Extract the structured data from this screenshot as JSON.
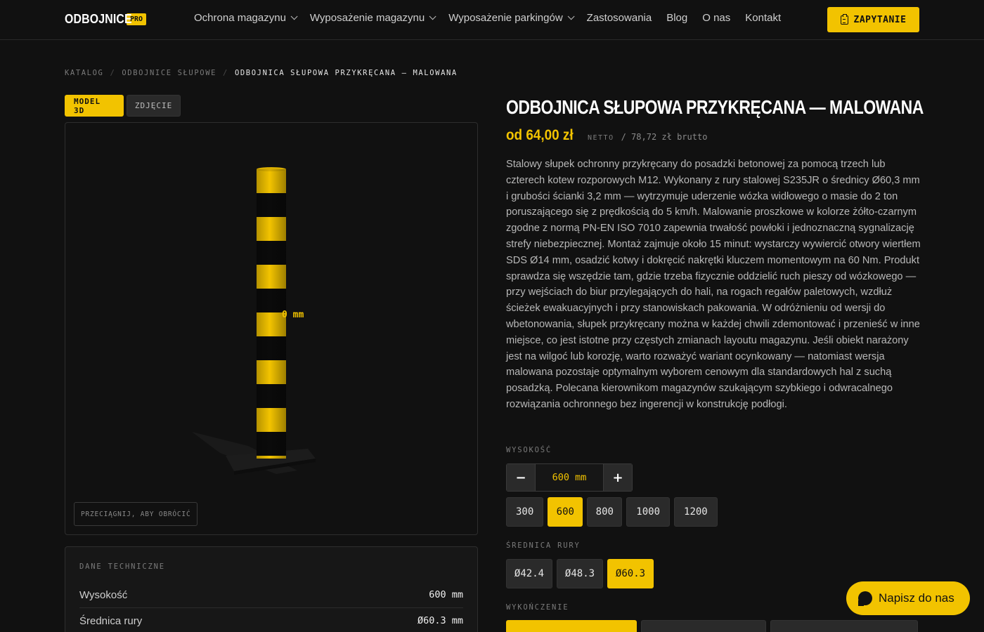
{
  "header": {
    "logo_text": "ODBOJNICE",
    "logo_badge": "PRO",
    "nav": [
      {
        "label": "Ochrona magazynu",
        "dropdown": true
      },
      {
        "label": "Wyposażenie magazynu",
        "dropdown": true
      },
      {
        "label": "Wyposażenie parkingów",
        "dropdown": true
      },
      {
        "label": "Zastosowania",
        "dropdown": false
      },
      {
        "label": "Blog",
        "dropdown": false
      },
      {
        "label": "O nas",
        "dropdown": false
      },
      {
        "label": "Kontakt",
        "dropdown": false
      }
    ],
    "cta_label": "ZAPYTANIE"
  },
  "breadcrumb": [
    "KATALOG",
    "ODBOJNICE SŁUPOWE",
    "ODBOJNICA SŁUPOWA PRZYKRĘCANA — MALOWANA"
  ],
  "viewer": {
    "tabs": [
      {
        "label": "MODEL 3D",
        "active": true
      },
      {
        "label": "ZDJĘCIE",
        "active": false
      }
    ],
    "dimension_label": "0 mm",
    "drag_hint": "PRZECIĄGNIJ, ABY OBRÓCIĆ"
  },
  "tech": {
    "title": "DANE TECHNICZNE",
    "rows": [
      {
        "key": "Wysokość",
        "value": "600 mm"
      },
      {
        "key": "Średnica rury",
        "value": "Ø60.3 mm"
      }
    ]
  },
  "product": {
    "title": "ODBOJNICA SŁUPOWA PRZYKRĘCANA — MALOWANA",
    "price_main": "od 64,00 zł",
    "price_net": "NETTO",
    "price_gross": "/ 78,72 zł brutto",
    "description": "Stalowy słupek ochronny przykręcany do posadzki betonowej za pomocą trzech lub czterech kotew rozporowych M12. Wykonany z rury stalowej S235JR o średnicy Ø60,3 mm i grubości ścianki 3,2 mm — wytrzymuje uderzenie wózka widłowego o masie do 2 ton poruszającego się z prędkością do 5 km/h. Malowanie proszkowe w kolorze żółto-czarnym zgodne z normą PN-EN ISO 7010 zapewnia trwałość powłoki i jednoznaczną sygnalizację strefy niebezpiecznej. Montaż zajmuje około 15 minut: wystarczy wywiercić otwory wiertłem SDS Ø14 mm, osadzić kotwy i dokręcić nakrętki kluczem momentowym na 60 Nm. Produkt sprawdza się wszędzie tam, gdzie trzeba fizycznie oddzielić ruch pieszy od wózkowego — przy wejściach do biur przylegających do hali, na rogach regałów paletowych, wzdłuż ścieżek ewakuacyjnych i przy stanowiskach pakowania. W odróżnieniu od wersji do wbetonowania, słupek przykręcany można w każdej chwili zdemontować i przenieść w inne miejsce, co jest istotne przy częstych zmianach layoutu magazynu. Jeśli obiekt narażony jest na wilgoć lub korozję, warto rozważyć wariant ocynkowany — natomiast wersja malowana pozostaje optymalnym wyborem cenowym dla standardowych hal z suchą posadzką. Polecana kierownikom magazynów szukającym szybkiego i odwracalnego rozwiązania ochronnego bez ingerencji w konstrukcję podłogi."
  },
  "options": {
    "height_label": "WYSOKOŚĆ",
    "height_value": "600 mm",
    "minus": "−",
    "plus": "+",
    "heights": [
      {
        "label": "300",
        "selected": false
      },
      {
        "label": "600",
        "selected": true
      },
      {
        "label": "800",
        "selected": false
      },
      {
        "label": "1000",
        "selected": false
      },
      {
        "label": "1200",
        "selected": false
      }
    ],
    "diameter_label": "ŚREDNICA RURY",
    "diameters": [
      {
        "label": "Ø42.4",
        "selected": false
      },
      {
        "label": "Ø48.3",
        "selected": false
      },
      {
        "label": "Ø60.3",
        "selected": true
      }
    ],
    "finish_label": "WYKOŃCZENIE"
  },
  "chat": {
    "label": "Napisz do nas"
  },
  "colors": {
    "accent": "#f2c300",
    "background": "#111111",
    "panel": "#2a2a2a"
  }
}
